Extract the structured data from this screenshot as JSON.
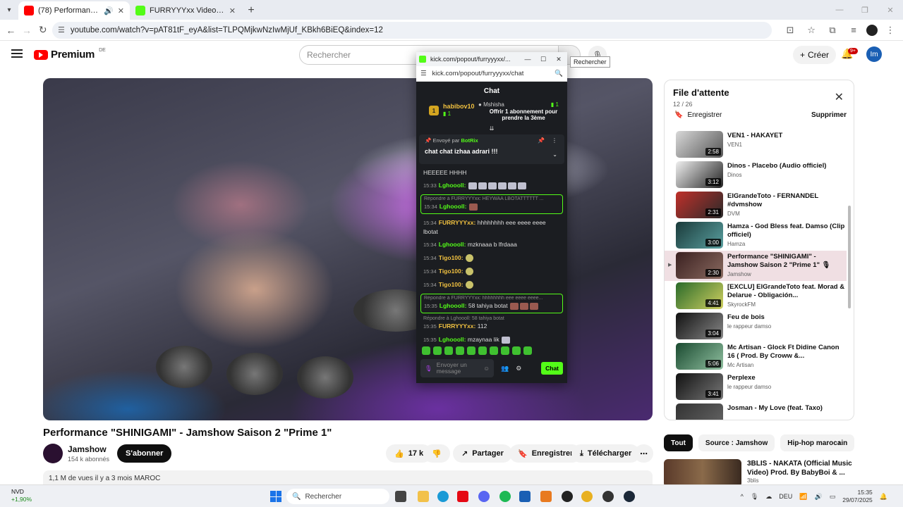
{
  "browser": {
    "tabs": [
      {
        "title": "(78) Performance \"SHINIGAMI\"",
        "active": true,
        "color": "#ff0000"
      },
      {
        "title": "FURRYYYxx Videos - Watch On",
        "active": false,
        "color": "#53fc18"
      }
    ],
    "url": "youtube.com/watch?v=pAT81tF_eyA&list=TLPQMjkwNzIwMjUf_KBkh6BiEQ&index=12"
  },
  "yt": {
    "logo": "Premium",
    "region": "DE",
    "search_placeholder": "Rechercher",
    "search_tooltip": "Rechercher",
    "create_label": "Créer",
    "notif_badge": "9+",
    "user_initials": "Im"
  },
  "video": {
    "title": "Performance \"SHINIGAMI\" - Jamshow Saison 2 \"Prime 1\"",
    "channel": "Jamshow",
    "subscribers": "154 k abonnés",
    "subscribe_label": "S'abonner",
    "likes": "17 k",
    "share_label": "Partager",
    "save_label": "Enregistrer",
    "download_label": "Télécharger",
    "desc_line": "1,1 M de vues   il y a 3 mois   MAROC"
  },
  "queue": {
    "title": "File d'attente",
    "count": "12 / 26",
    "save_label": "Enregistrer",
    "delete_label": "Supprimer",
    "items": [
      {
        "title": "VEN1 - HAKAYET",
        "channel": "VEN1",
        "duration": "2:58",
        "c1": "#d8d8d8",
        "c2": "#555555",
        "current": false
      },
      {
        "title": "Dinos - Placebo (Audio officiel)",
        "channel": "Dinos",
        "duration": "3:12",
        "c1": "#f0f0f0",
        "c2": "#222222",
        "current": false
      },
      {
        "title": "ElGrandeToto - FERNANDEL #dvmshow",
        "channel": "DVM",
        "duration": "2:31",
        "c1": "#c0302a",
        "c2": "#2a2a2a",
        "current": false
      },
      {
        "title": "Hamza - God Bless feat. Damso (Clip officiel)",
        "channel": "Hamza",
        "duration": "3:00",
        "c1": "#1a3a3a",
        "c2": "#5aa0a0",
        "current": false
      },
      {
        "title": "Performance \"SHINIGAMI\" - Jamshow Saison 2 \"Prime 1\" 🎙",
        "channel": "Jamshow",
        "duration": "2:30",
        "c1": "#3a2020",
        "c2": "#8a6a60",
        "current": true
      },
      {
        "title": "[EXCLU] ElGrandeToto feat. Morad & Delarue - Obligación...",
        "channel": "SkyrockFM",
        "duration": "4:41",
        "c1": "#2a6a2a",
        "c2": "#d0d060",
        "current": false
      },
      {
        "title": "Feu de bois",
        "channel": "le rappeur damso",
        "duration": "3:04",
        "c1": "#111111",
        "c2": "#888888",
        "current": false
      },
      {
        "title": "Mc Artisan - Glock Ft Didine Canon 16 ( Prod. By Croww &...",
        "channel": "Mc Artisan",
        "duration": "5:06",
        "c1": "#1a4a30",
        "c2": "#90c0a0",
        "current": false
      },
      {
        "title": "Perplexe",
        "channel": "le rappeur damso",
        "duration": "3:41",
        "c1": "#111111",
        "c2": "#777777",
        "current": false
      },
      {
        "title": "Josman - My Love (feat. Taxo)",
        "channel": "",
        "duration": "",
        "c1": "#333333",
        "c2": "#666666",
        "current": false
      }
    ]
  },
  "chips": [
    "Tout",
    "Source : Jamshow",
    "Hip-hop marocain"
  ],
  "recommendation": {
    "title": "3BLIS - NAKATA (Official Music Video) Prod. By BabyBoi & ...",
    "channel": "3blis"
  },
  "kick": {
    "window_title": "kick.com/popout/furryyyxx/...",
    "url": "kick.com/popout/furryyyxx/chat",
    "header": "Chat",
    "leader_rank": "1",
    "leader_name": "habibov10",
    "leader_subs": "1",
    "leader_right_name": "Mshisha",
    "leader_right_text": "Offrir 1 abonnement pour prendre la 3ème",
    "leader_right_count": "1",
    "pin_sent_by": "Envoyé par",
    "pin_bot": "BotRix",
    "pin_message": "chat chat izhaa adrari !!!",
    "input_placeholder": "Envoyer un message",
    "chat_button": "Chat",
    "messages": {
      "m0": "HEEEEE HHHH",
      "m1_ts": "15:33",
      "m1_user": "Lghoooll:",
      "m2_reply": "Répondre à FURRYYYxx: HEYWAA LBOTATTTTTT ...",
      "m2_ts": "15:34",
      "m2_user": "Lghoooll:",
      "m3_ts": "15:34",
      "m3_user": "FURRYYYxx:",
      "m3_text": "hhhhhhhh eee eeee eeee lbotat",
      "m4_ts": "15:34",
      "m4_user": "Lghoooll:",
      "m4_text": "mzknaaa b lfrdaaa",
      "m5_ts": "15:34",
      "m5_user": "Tigo100:",
      "m6_ts": "15:34",
      "m6_user": "Tigo100:",
      "m7_ts": "15:34",
      "m7_user": "Tigo100:",
      "m8_reply": "Répondre à FURRYYYxx: hhhhhhhh eee eeee eeee...",
      "m8_ts": "15:35",
      "m8_user": "Lghoooll:",
      "m8_text": "58 tahiya botat",
      "m9_reply": "Répondre à Lghoooll: 58 tahiya botat",
      "m9_ts": "15:35",
      "m9_user": "FURRYYYxx:",
      "m9_text": "112",
      "m10_ts": "15:35",
      "m10_user": "Lghoooll:",
      "m10_text": "mzaynaa lik"
    }
  },
  "taskbar": {
    "stock_name": "NVD",
    "stock_change": "+1,90%",
    "search_label": "Rechercher",
    "lang": "DEU",
    "time": "15:35",
    "date": "29/07/2025"
  }
}
